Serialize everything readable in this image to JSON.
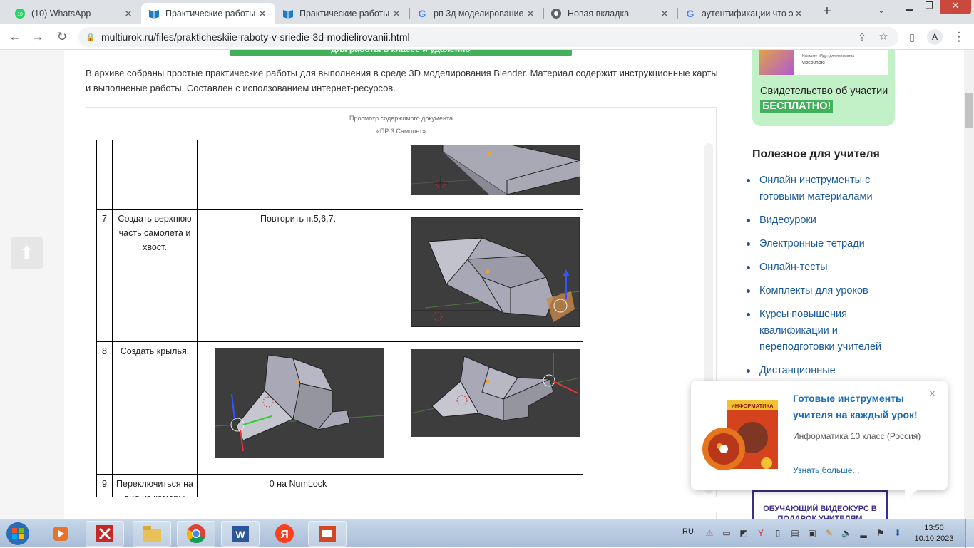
{
  "browser": {
    "tabs": [
      {
        "label": "(10) WhatsApp",
        "icon": "whatsapp-icon",
        "active": false
      },
      {
        "label": "Практические работы",
        "icon": "multiurok-icon",
        "active": true
      },
      {
        "label": "Практические работы",
        "icon": "multiurok-icon",
        "active": false
      },
      {
        "label": "рп 3д моделирование",
        "icon": "google-icon",
        "active": false
      },
      {
        "label": "Новая вкладка",
        "icon": "chrome-icon",
        "active": false
      },
      {
        "label": "аутентификации что это",
        "icon": "google-icon",
        "active": false
      }
    ],
    "new_tab": "+",
    "url": "multiurok.ru/files/prakticheskiie-raboty-v-sriedie-3d-modielirovanii.html",
    "profile_initial": "A"
  },
  "page": {
    "banner": "для работы в классе и удаленно",
    "intro": "В архиве собраны простые практические работы для выполнения в среде 3D моделирования Blender. Материал содержит инструкционные карты и выполненые работы. Составлен с исползованием интернет-ресурсов.",
    "viewer_title": "Просмотр содержимого документа",
    "viewer_doc": "«ПР 3 Самолет»",
    "rows": [
      {
        "num": "",
        "task": "",
        "action": ""
      },
      {
        "num": "7",
        "task": "Создать верхнюю часть самолета и хвост.",
        "action": "Повторить п.5,6,7."
      },
      {
        "num": "8",
        "task": "Создать крылья.",
        "action": ""
      },
      {
        "num": "9",
        "task": "Переключиться на вид из камеры",
        "action": "0 на NumLock"
      }
    ]
  },
  "sidebar": {
    "promo_text": "Свидетельство об участии",
    "promo_badge": "БЕСПЛАТНО!",
    "promo_small1": "Нажмите «Иду» для просмотра",
    "promo_small2": "VIDEOUROKI",
    "useful_title": "Полезное для учителя",
    "useful_items": [
      "Онлайн инструменты с готовыми материалами",
      "Видеоуроки",
      "Электронные тетради",
      "Онлайн-тесты",
      "Комплекты для уроков",
      "Курсы повышения квалификации и переподготовки учителей",
      "Дистанционные"
    ],
    "video_course": "ОБУЧАЮЩИЙ ВИДЕОКУРС В ПОДАРОК УЧИТЕЛЯМ"
  },
  "popup": {
    "title": "Готовые инструменты учителя на каждый урок!",
    "subtitle": "Информатика 10 класс (Россия)",
    "link": "Узнать больше...",
    "close": "×",
    "book_label": "ИНФОРМАТИКА"
  },
  "taskbar": {
    "lang": "RU",
    "time": "13:50",
    "date": "10.10.2023"
  }
}
